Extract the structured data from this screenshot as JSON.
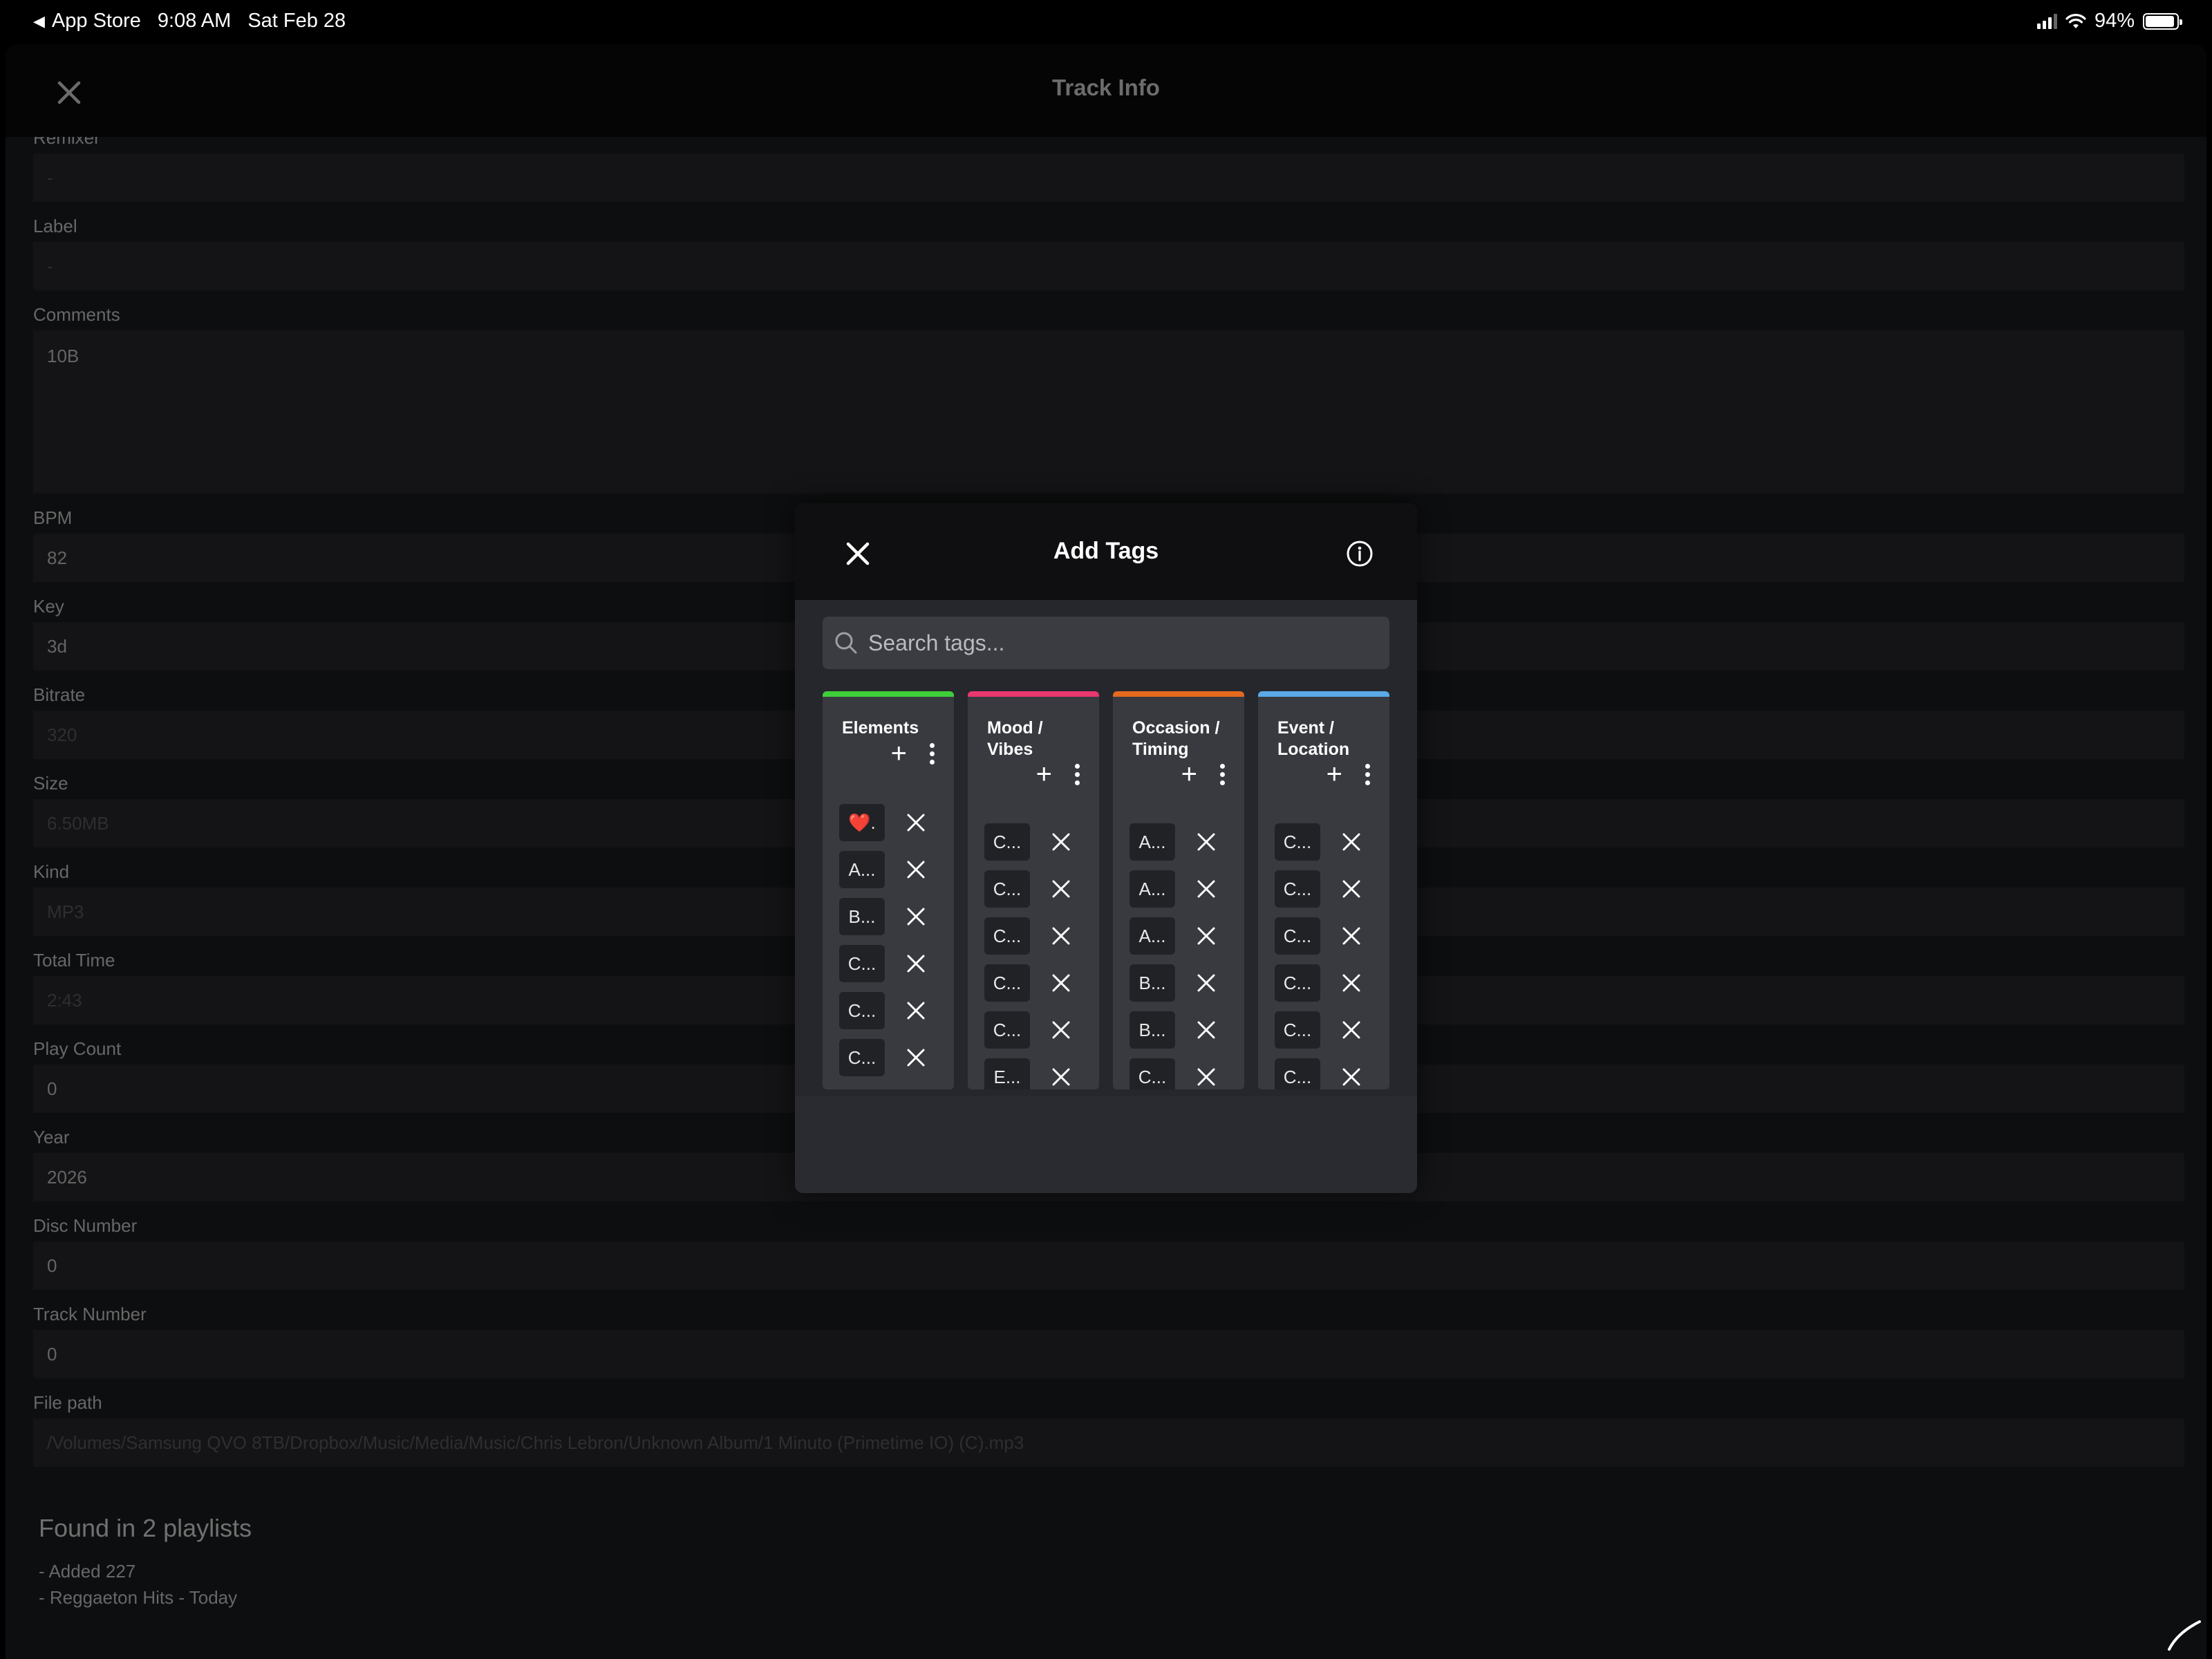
{
  "status_bar": {
    "back_app": "App Store",
    "time": "9:08 AM",
    "date": "Sat Feb 28",
    "battery": "94%",
    "battery_level": 0.94
  },
  "track_info": {
    "title": "Track Info",
    "fields": [
      {
        "label": "Remixer",
        "value": "-",
        "dim": true
      },
      {
        "label": "Label",
        "value": "-",
        "dim": true
      },
      {
        "label": "Comments",
        "value": "10B",
        "dim": false,
        "tall": true
      },
      {
        "label": "BPM",
        "value": "82",
        "dim": false
      },
      {
        "label": "Key",
        "value": "3d",
        "dim": false
      },
      {
        "label": "Bitrate",
        "value": "320",
        "dim": true
      },
      {
        "label": "Size",
        "value": "6.50MB",
        "dim": true
      },
      {
        "label": "Kind",
        "value": "MP3",
        "dim": true
      },
      {
        "label": "Total Time",
        "value": "2:43",
        "dim": true
      },
      {
        "label": "Play Count",
        "value": "0",
        "dim": false
      },
      {
        "label": "Year",
        "value": "2026",
        "dim": false
      },
      {
        "label": "Disc Number",
        "value": "0",
        "dim": false
      },
      {
        "label": "Track Number",
        "value": "0",
        "dim": false
      },
      {
        "label": "File path",
        "value": "/Volumes/Samsung QVO 8TB/Dropbox/Music/Media/Music/Chris Lebron/Unknown Album/1 Minuto (Primetime IO) (C).mp3",
        "dim": true
      }
    ],
    "playlists": {
      "heading": "Found in 2 playlists",
      "items": [
        "- Added 227",
        "- Reggaeton Hits - Today"
      ]
    }
  },
  "add_tags": {
    "title": "Add Tags",
    "search_placeholder": "Search tags...",
    "columns": [
      {
        "title": "Elements",
        "color": "#3ecf3a",
        "tags": [
          "❤️.",
          "A...",
          "B...",
          "C...",
          "C...",
          "C..."
        ]
      },
      {
        "title": "Mood / Vibes",
        "color": "#e8386e",
        "tags": [
          "C...",
          "C...",
          "C...",
          "C...",
          "C...",
          "E..."
        ]
      },
      {
        "title": "Occasion / Timing",
        "color": "#e36a1e",
        "tags": [
          "A...",
          "A...",
          "A...",
          "B...",
          "B...",
          "C..."
        ]
      },
      {
        "title": "Event / Location",
        "color": "#5aa9e6",
        "tags": [
          "C...",
          "C...",
          "C...",
          "C...",
          "C...",
          "C..."
        ]
      }
    ]
  }
}
